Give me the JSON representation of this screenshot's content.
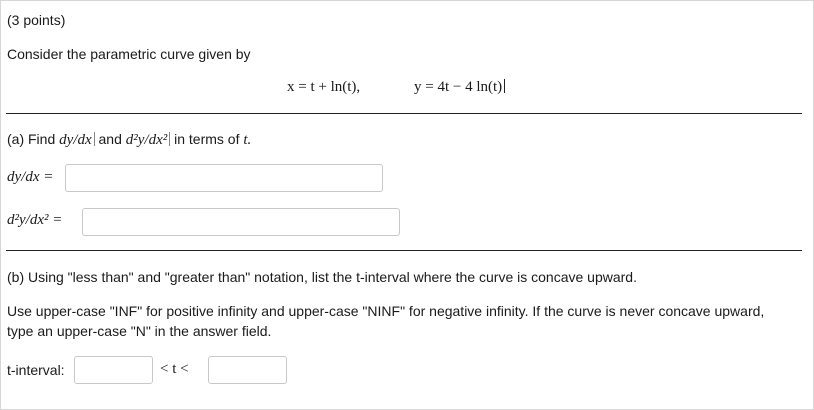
{
  "points": "(3 points)",
  "intro": "Consider the parametric curve given by",
  "equation": {
    "x": "x = t + ln(t),",
    "y": "y = 4t − 4 ln(t)"
  },
  "part_a": {
    "prefix": "(a) Find",
    "term1": "dy/dx",
    "and": "and",
    "term2": "d²y/dx²",
    "suffix": "in terms of",
    "var": "t.",
    "dydx_label": "dy/dx =",
    "d2ydx2_label": "d²y/dx² =",
    "dydx_value": "",
    "d2ydx2_value": ""
  },
  "part_b": {
    "line1": "(b) Using \"less than\" and \"greater than\" notation, list the t-interval where the curve is concave upward.",
    "line2": "Use upper-case \"INF\" for positive infinity and upper-case \"NINF\" for negative infinity. If the curve is never concave upward,",
    "line3": "type an upper-case \"N\" in the answer field.",
    "interval_label": "t-interval:",
    "between": "< t <",
    "lower_value": "",
    "upper_value": ""
  }
}
